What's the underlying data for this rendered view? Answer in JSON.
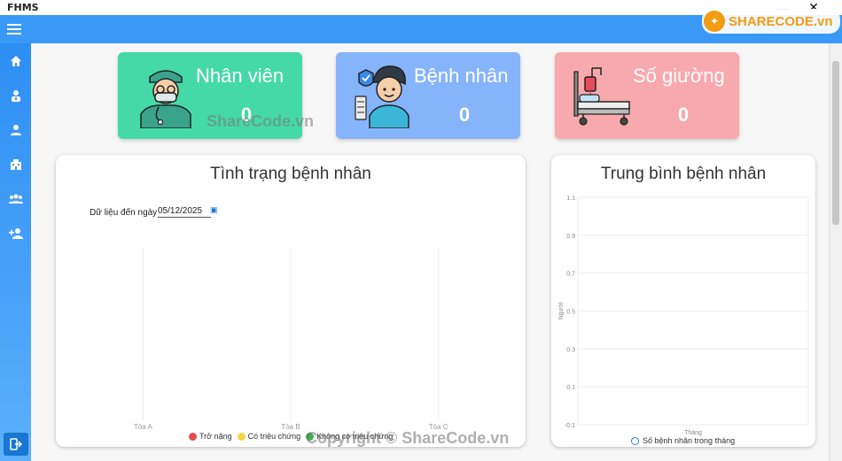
{
  "app": {
    "title": "FHMS"
  },
  "window": {
    "minimize": "—",
    "close": "✕"
  },
  "watermark": {
    "logo_text": "SHARECODE.vn",
    "center_text": "ShareCode.vn",
    "copyright_text": "Copyright © ShareCode.vn"
  },
  "sidebar": {
    "items": [
      {
        "name": "home-icon"
      },
      {
        "name": "doctor-icon"
      },
      {
        "name": "person-icon"
      },
      {
        "name": "building-icon"
      },
      {
        "name": "group-icon"
      },
      {
        "name": "add-user-icon"
      }
    ],
    "logout": {
      "name": "logout-icon"
    }
  },
  "cards": [
    {
      "label": "Nhân viên",
      "value": "0",
      "color": "#46d9a8",
      "icon": "doctor-avatar-icon"
    },
    {
      "label": "Bệnh nhân",
      "value": "0",
      "color": "#86b4fb",
      "icon": "patient-avatar-icon"
    },
    {
      "label": "Số giường",
      "value": "0",
      "color": "#f8a9ad",
      "icon": "hospital-bed-icon"
    }
  ],
  "status_panel": {
    "title": "Tình trạng bệnh nhân",
    "date_label": "Dữ liệu đến ngày",
    "date_value": "05/12/2025",
    "legend": [
      {
        "label": "Trở nặng",
        "color": "#e84a4a"
      },
      {
        "label": "Có triệu chứng",
        "color": "#f6d545"
      },
      {
        "label": "Không có triệu chứng",
        "color": "#3cb54a"
      }
    ]
  },
  "avg_panel": {
    "title": "Trung bình bệnh nhân",
    "legend": "Số bệnh nhân trong tháng"
  },
  "chart_data": [
    {
      "type": "bar",
      "categories": [
        "Tòa A",
        "Tòa B",
        "Tòa C"
      ],
      "series": [
        {
          "name": "Trở nặng",
          "values": [
            0,
            0,
            0
          ]
        },
        {
          "name": "Có triệu chứng",
          "values": [
            0,
            0,
            0
          ]
        },
        {
          "name": "Không có triệu chứng",
          "values": [
            0,
            0,
            0
          ]
        }
      ],
      "legend_position": "bottom",
      "grid": true
    },
    {
      "type": "line",
      "title": "Trung bình bệnh nhân",
      "xlabel": "Tháng",
      "ylabel": "Người",
      "y_ticks": [
        "1.1",
        "0.9",
        "0.7",
        "0.5",
        "0.3",
        "0.1",
        "-0.1"
      ],
      "ylim": [
        -0.1,
        1.1
      ],
      "series": [
        {
          "name": "Số bệnh nhân trong tháng",
          "values": []
        }
      ],
      "legend_position": "bottom",
      "grid": true
    }
  ]
}
